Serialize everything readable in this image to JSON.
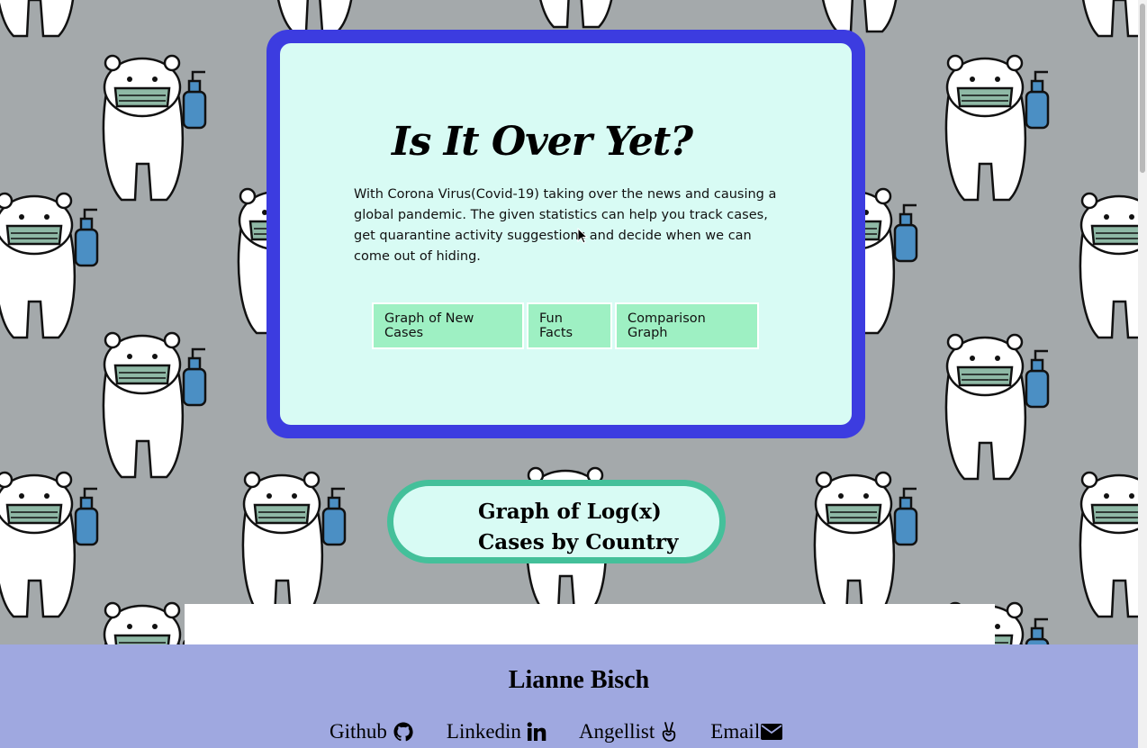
{
  "hero": {
    "title": "Is It Over Yet?",
    "intro": "With Corona Virus(Covid-19) taking over the news and causing a global pandemic. The given statistics can help you track cases, get quarantine activity suggestions and decide when we can come out of hiding.",
    "buttons": [
      "Graph of New Cases",
      "Fun Facts",
      "Comparison Graph"
    ]
  },
  "section": {
    "title_line1": "Graph of Log(x)",
    "title_line2": "Cases by Country"
  },
  "footer": {
    "author": "Lianne Bisch",
    "links": [
      {
        "label": "Github",
        "icon": "github-icon"
      },
      {
        "label": "Linkedin",
        "icon": "linkedin-icon"
      },
      {
        "label": "Angellist",
        "icon": "angellist-icon"
      },
      {
        "label": "Email",
        "icon": "envelope-icon"
      }
    ]
  },
  "colors": {
    "background": "#a4a9ab",
    "hero_border": "#3c3ce0",
    "panel": "#d8fbf4",
    "button": "#9ef0c3",
    "pill_border": "#44c09a",
    "footer": "#9fa8e0"
  }
}
